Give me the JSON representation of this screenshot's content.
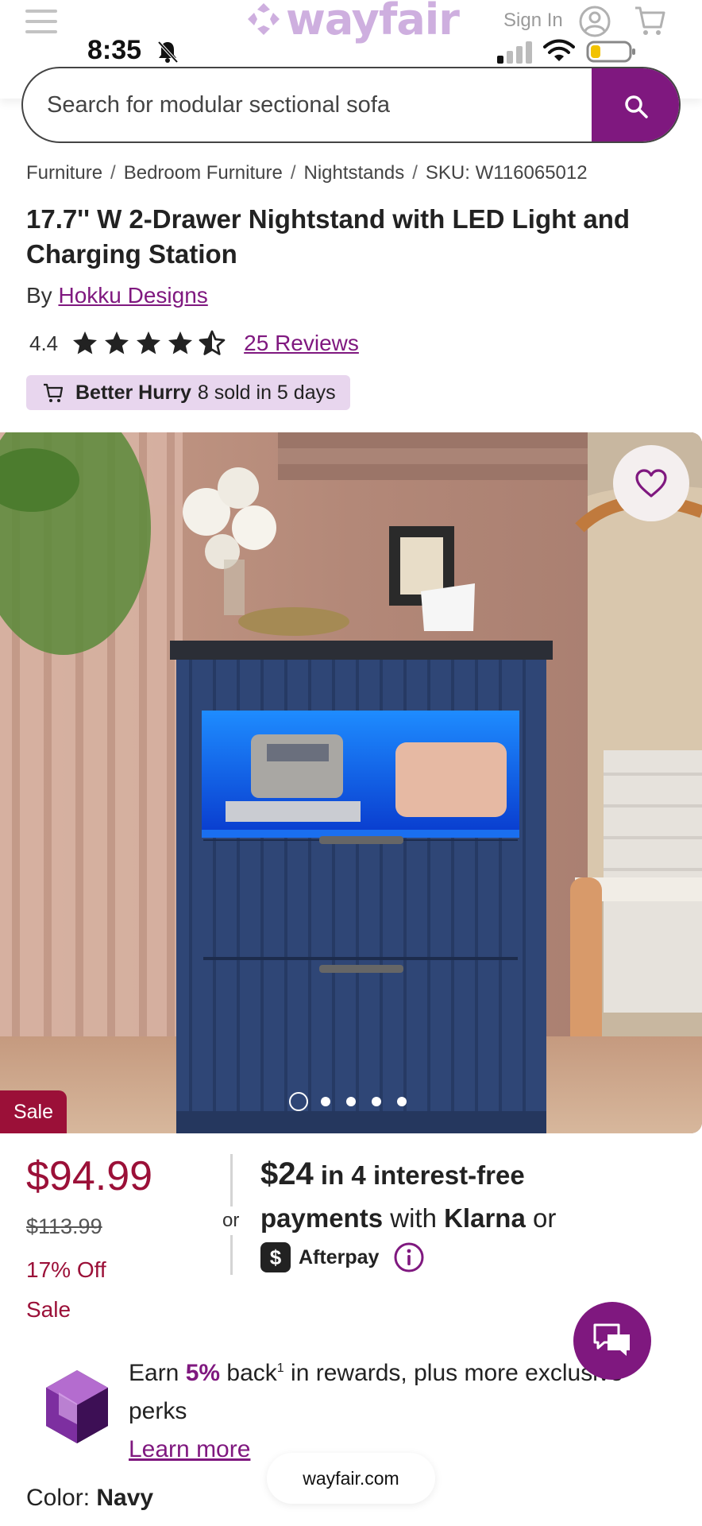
{
  "status_bar": {
    "time": "8:35"
  },
  "header": {
    "logo_text": "wayfair",
    "sign_in": "Sign In",
    "icons": [
      "menu-icon",
      "user-icon",
      "cart-icon",
      "bell-slash-icon",
      "signal-icon",
      "wifi-icon",
      "battery-icon"
    ]
  },
  "search": {
    "placeholder": "Search for modular sectional sofa"
  },
  "breadcrumb": {
    "items": [
      "Furniture",
      "Bedroom Furniture",
      "Nightstands"
    ],
    "separator": "/",
    "sku": "SKU: W116065012"
  },
  "product": {
    "title": "17.7'' W 2-Drawer Nightstand with LED Light and Charging Station",
    "by_label": "By",
    "brand": "Hokku Designs",
    "rating": "4.4",
    "rating_value": 4.4,
    "reviews": "25 Reviews",
    "badge_bold": "Better Hurry",
    "badge_text": "8 sold in 5 days",
    "sale_tag": "Sale",
    "image_count": 5,
    "image_index": 1
  },
  "pricing": {
    "price": "$94.99",
    "was_price": "$113.99",
    "off": "17% Off",
    "sale": "Sale",
    "or": "or",
    "klarna_amount": "$24",
    "klarna_rest": "in 4 interest-free",
    "klarna_payments": "payments",
    "klarna_with": "with",
    "klarna_brand": "Klarna",
    "klarna_or": "or",
    "afterpay": "Afterpay"
  },
  "rewards": {
    "earn": "Earn",
    "pct": "5%",
    "back": "back",
    "sup": "1",
    "rest": "in rewards, plus more exclusive perks",
    "learn_more": "Learn more"
  },
  "color": {
    "label": "Color:",
    "value": "Navy"
  },
  "browser": {
    "url": "wayfair.com"
  },
  "colors": {
    "brand_purple": "#7f187f",
    "sale_red": "#9b1038",
    "badge_bg": "#e8d6ee"
  }
}
